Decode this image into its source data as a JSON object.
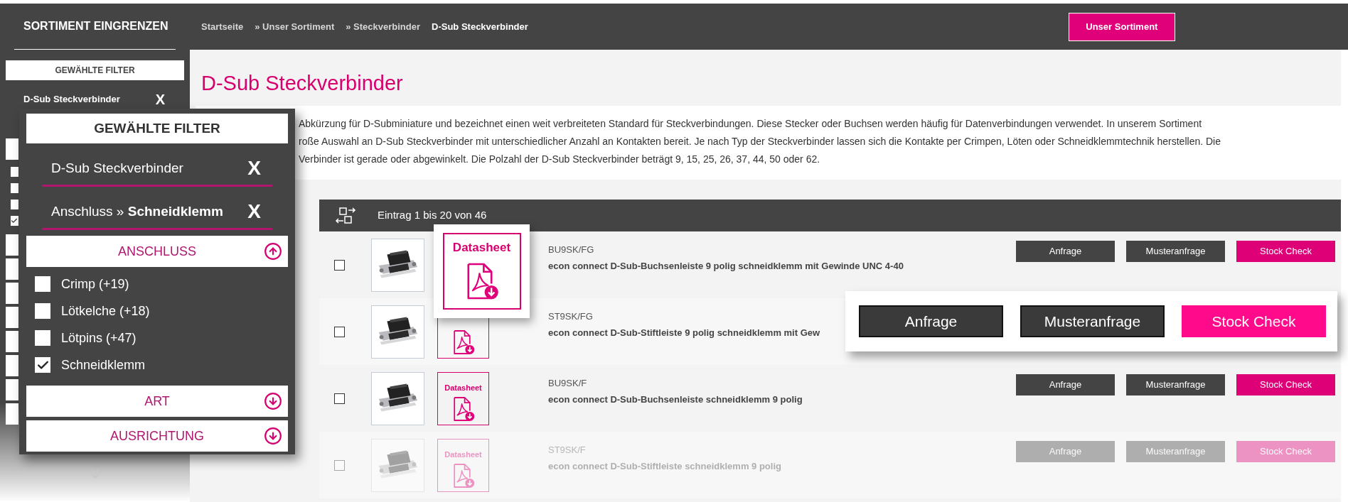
{
  "header": {
    "sidebar_title": "SORTIMENT EINGRENZEN",
    "breadcrumbs": [
      {
        "label": "Startseite",
        "current": false
      },
      {
        "label": "» Unser Sortiment",
        "current": false
      },
      {
        "label": "» Steckverbinder",
        "current": false
      },
      {
        "label": "D-Sub Steckverbinder",
        "current": true
      }
    ],
    "button": "Unser Sortiment"
  },
  "sidebar": {
    "heading": "GEWÄHLTE FILTER",
    "filters": [
      {
        "label": "D-Sub Steckverbinder",
        "remove": "X"
      }
    ],
    "checkboxes": [
      {
        "checked": false
      },
      {
        "checked": false
      },
      {
        "checked": false
      },
      {
        "checked": true
      }
    ]
  },
  "page": {
    "title": "D-Sub Steckverbinder",
    "description": [
      "Abkürzung für D-Subminiature und bezeichnet einen weit verbreiteten Standard für Steckverbindungen. Diese Stecker oder Buchsen werden häufig für Datenverbindungen verwendet. In unserem Sortiment",
      "roße Auswahl an D-Sub Steckverbinder mit unterschiedlicher Anzahl an Kontakten bereit. Je nach Typ der Steckverbinder lassen sich die Kontakte per Crimpen, Löten oder Schneidklemmtechnik herstellen. Die",
      "Verbinder ist gerade oder abgewinkelt. Die Polzahl der D-Sub Steckverbinder beträgt 9, 15, 25, 26, 37, 44, 50 oder 62."
    ]
  },
  "filter_panel": {
    "heading": "GEWÄHLTE FILTER",
    "filters": [
      {
        "label": "D-Sub Steckverbinder",
        "remove": "X"
      },
      {
        "label": "Anschluss » **Schneidklemm**",
        "remove": "X"
      }
    ],
    "sections": [
      {
        "title": "ANSCHLUSS",
        "expanded": true,
        "options": [
          {
            "label": "Crimp (+19)",
            "checked": false
          },
          {
            "label": "Lötkelche (+18)",
            "checked": false
          },
          {
            "label": "Lötpins (+47)",
            "checked": false
          },
          {
            "label": "Schneidklemm",
            "checked": true
          }
        ]
      },
      {
        "title": "ART",
        "expanded": false
      },
      {
        "title": "AUSRICHTUNG",
        "expanded": false
      }
    ]
  },
  "table": {
    "info": "Eintrag 1 bis 20 von 46",
    "rows": [
      {
        "checked": false,
        "faded": false,
        "kind": "zoomed",
        "datasheet": "Datasheet",
        "code": "BU9SK/FG",
        "name": "econ connect D-Sub-Buchsenleiste 9 polig schneidklemm mit Gewinde UNC 4-40",
        "buttons": [
          {
            "label": "Anfrage",
            "kind": "dark"
          },
          {
            "label": "Musteranfrage",
            "kind": "dark"
          },
          {
            "label": "Stock Check",
            "kind": "accent"
          }
        ]
      },
      {
        "checked": false,
        "faded": false,
        "kind": "normal",
        "code": "ST9SK/FG",
        "name": "econ connect D-Sub-Stiftleiste 9 polig schneidklemm mit Gew"
      },
      {
        "checked": false,
        "faded": false,
        "kind": "normal",
        "datasheet": "Datasheet",
        "code": "BU9SK/F",
        "name": "econ connect D-Sub-Buchsenleiste schneidklemm 9 polig",
        "buttons": [
          {
            "label": "Anfrage",
            "kind": "dark"
          },
          {
            "label": "Musteranfrage",
            "kind": "dark"
          },
          {
            "label": "Stock Check",
            "kind": "accent"
          }
        ]
      },
      {
        "checked": false,
        "faded": true,
        "kind": "normal",
        "datasheet": "Datasheet",
        "code": "ST9SK/F",
        "name": "econ connect D-Sub-Stiftleiste schneidklemm 9 polig",
        "buttons": [
          {
            "label": "Anfrage",
            "kind": "dark"
          },
          {
            "label": "Musteranfrage",
            "kind": "dark"
          },
          {
            "label": "Stock Check",
            "kind": "accent"
          }
        ]
      }
    ]
  },
  "button_zoom": {
    "buttons": [
      {
        "label": "Anfrage",
        "kind": "dark"
      },
      {
        "label": "Musteranfrage",
        "kind": "dark"
      },
      {
        "label": "Stock Check",
        "kind": "accent"
      }
    ]
  }
}
